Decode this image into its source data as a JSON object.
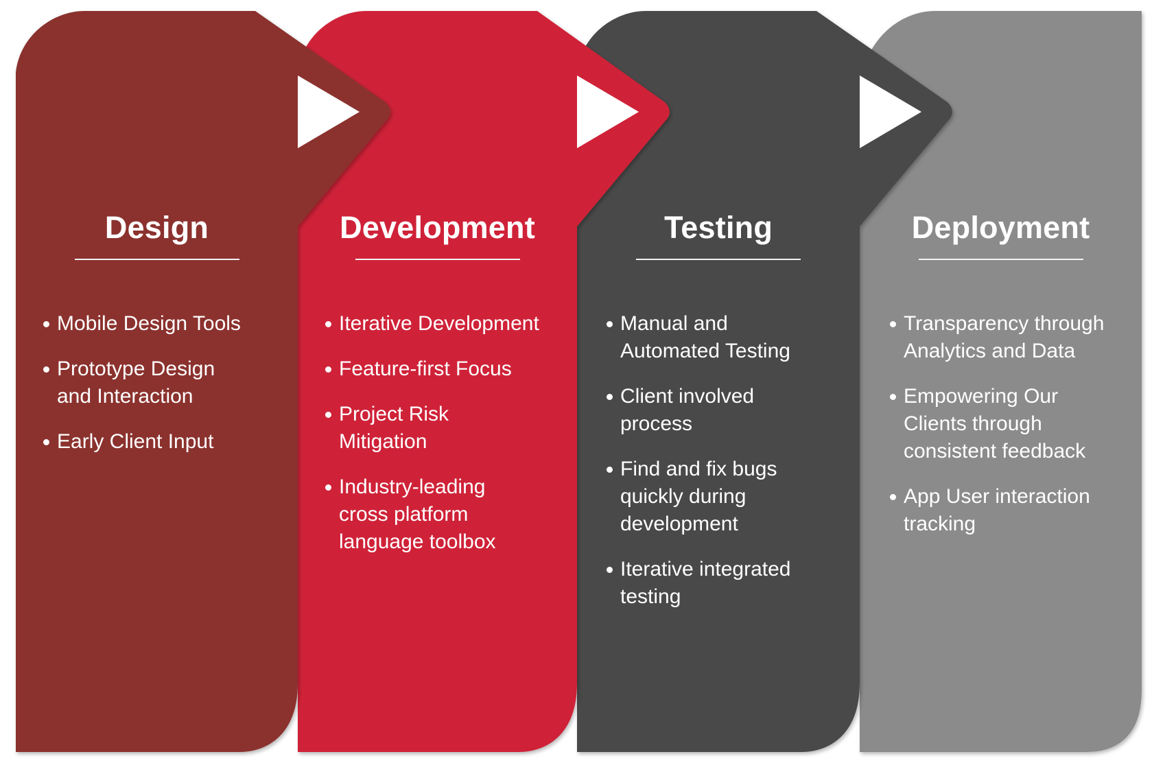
{
  "diagram": {
    "type": "process-flow",
    "stages": [
      {
        "title": "Design",
        "color": "#8B302D",
        "items": [
          [
            "Mobile Design Tools"
          ],
          [
            "Prototype Design",
            "and Interaction"
          ],
          [
            "Early Client Input"
          ]
        ]
      },
      {
        "title": "Development",
        "color": "#CF2139",
        "items": [
          [
            "Iterative Development"
          ],
          [
            "Feature-first Focus"
          ],
          [
            "Project Risk",
            "Mitigation"
          ],
          [
            "Industry-leading",
            "cross platform",
            "language toolbox"
          ]
        ]
      },
      {
        "title": "Testing",
        "color": "#4A4A4A",
        "items": [
          [
            "Manual and",
            "Automated Testing"
          ],
          [
            "Client involved",
            "process"
          ],
          [
            "Find and fix bugs",
            "quickly during",
            "development"
          ],
          [
            "Iterative integrated",
            "testing"
          ]
        ]
      },
      {
        "title": "Deployment",
        "color": "#8A8B8A",
        "items": [
          [
            "Transparency through",
            "Analytics and Data"
          ],
          [
            "Empowering Our",
            "Clients through",
            "consistent feedback"
          ],
          [
            "App User interaction",
            "tracking"
          ]
        ]
      }
    ],
    "connector_icon": "play-arrow-icon",
    "connector_color": "#ffffff",
    "text_color": "#ffffff",
    "background": "#ffffff"
  }
}
